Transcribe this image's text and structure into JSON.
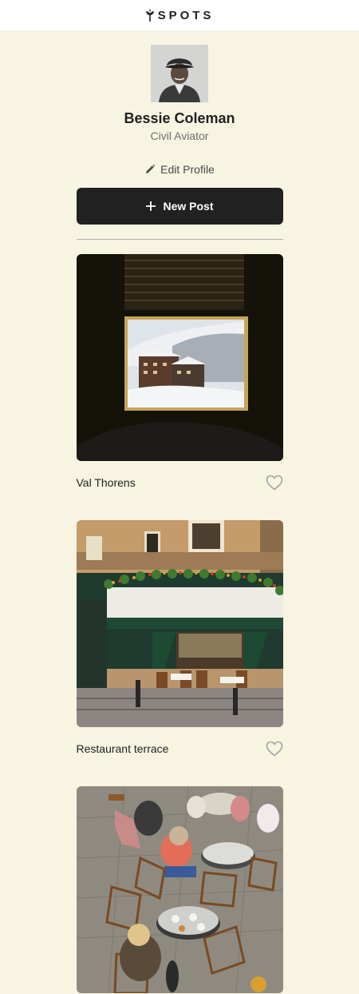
{
  "header": {
    "brand": "SPOTS",
    "logo_icon": "sprout-icon"
  },
  "profile": {
    "name": "Bessie Coleman",
    "role": "Civil Aviator",
    "edit_label": "Edit Profile",
    "new_post_label": "New Post"
  },
  "cards": [
    {
      "title": "Val Thorens",
      "image": "snowy-village-through-window",
      "liked": false
    },
    {
      "title": "Restaurant terrace",
      "image": "parisian-restaurant-storefront",
      "liked": false
    },
    {
      "title": "",
      "image": "cafe-tables-overhead",
      "liked": false
    }
  ],
  "colors": {
    "background": "#f7f4e2",
    "header": "#ffffff",
    "button": "#212121",
    "text": "#212121",
    "muted": "#6e6e6e"
  }
}
